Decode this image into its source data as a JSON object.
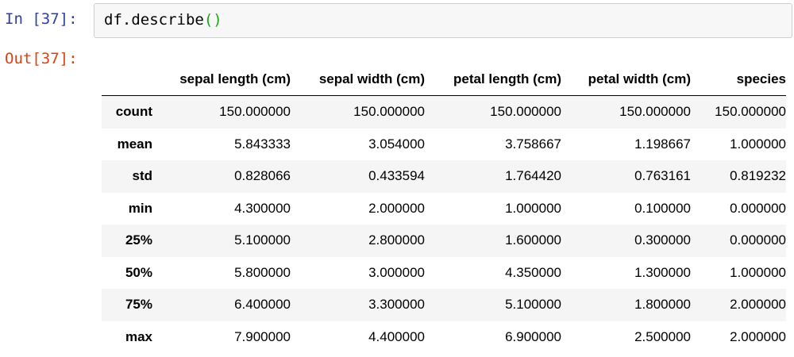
{
  "input_cell": {
    "prompt": "In [37]:",
    "code_object": "df.describe",
    "code_parens": "()"
  },
  "output_cell": {
    "prompt": "Out[37]:"
  },
  "table": {
    "corner": "",
    "columns": [
      "sepal length (cm)",
      "sepal width (cm)",
      "petal length (cm)",
      "petal width (cm)",
      "species"
    ],
    "rows": [
      {
        "index": "count",
        "values": [
          "150.000000",
          "150.000000",
          "150.000000",
          "150.000000",
          "150.000000"
        ]
      },
      {
        "index": "mean",
        "values": [
          "5.843333",
          "3.054000",
          "3.758667",
          "1.198667",
          "1.000000"
        ]
      },
      {
        "index": "std",
        "values": [
          "0.828066",
          "0.433594",
          "1.764420",
          "0.763161",
          "0.819232"
        ]
      },
      {
        "index": "min",
        "values": [
          "4.300000",
          "2.000000",
          "1.000000",
          "0.100000",
          "0.000000"
        ]
      },
      {
        "index": "25%",
        "values": [
          "5.100000",
          "2.800000",
          "1.600000",
          "0.300000",
          "0.000000"
        ]
      },
      {
        "index": "50%",
        "values": [
          "5.800000",
          "3.000000",
          "4.350000",
          "1.300000",
          "1.000000"
        ]
      },
      {
        "index": "75%",
        "values": [
          "6.400000",
          "3.300000",
          "5.100000",
          "1.800000",
          "2.000000"
        ]
      },
      {
        "index": "max",
        "values": [
          "7.900000",
          "4.400000",
          "6.900000",
          "2.500000",
          "2.000000"
        ]
      }
    ]
  },
  "colors": {
    "in_prompt": "#303f9f",
    "out_prompt": "#d84315",
    "code_paren": "#19a619",
    "input_background": "#f7f7f7",
    "striped_row": "#f5f5f5"
  }
}
